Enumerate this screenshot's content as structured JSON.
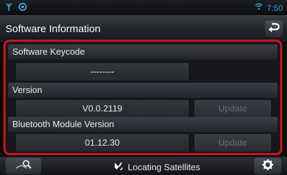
{
  "status_bar": {
    "time": "7:50",
    "icons": [
      "antenna-icon",
      "location-icon",
      "wifi-icon"
    ]
  },
  "header": {
    "title": "Software Information",
    "back_icon": "back-arrow-icon"
  },
  "sections": [
    {
      "label": "Software Keycode",
      "value": "--------",
      "button": ""
    },
    {
      "label": "Version",
      "value": "V0.0.2119",
      "button": "Update"
    },
    {
      "label": "Bluetooth Module Version",
      "value": "01.12.30",
      "button": "Update"
    }
  ],
  "footer": {
    "status_text": "Locating Satellites",
    "left_icon": "search-map-icon",
    "right_icon": "gear-icon"
  },
  "colors": {
    "highlight_border": "#d3131c",
    "accent": "#3aa0d8"
  }
}
